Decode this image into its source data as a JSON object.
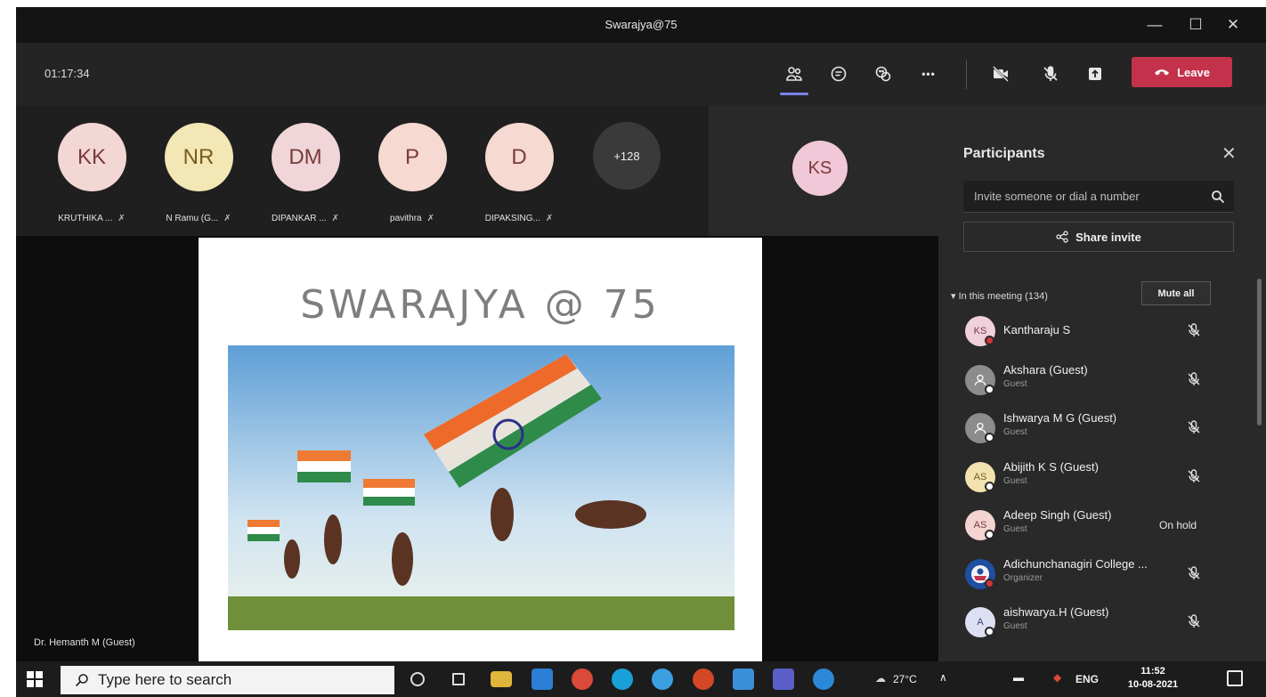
{
  "window": {
    "title": "Swarajya@75"
  },
  "window_controls": {
    "minimize": "—",
    "maximize": "☐",
    "close": "✕"
  },
  "toolbar": {
    "timer": "01:17:34",
    "leave_label": "Leave",
    "more_label": "•••",
    "icons": [
      "people-icon",
      "chat-icon",
      "reactions-icon",
      "more-icon",
      "camera-off-icon",
      "mic-off-icon",
      "share-tray-icon"
    ]
  },
  "gallery": {
    "tiles": [
      {
        "initials": "KK",
        "name": "KRUTHIKA ...",
        "color": "#f3d7d4"
      },
      {
        "initials": "NR",
        "name": "N Ramu (G...",
        "color": "#f2e7b5"
      },
      {
        "initials": "DM",
        "name": "DIPANKAR ...",
        "color": "#f0d6d9"
      },
      {
        "initials": "P",
        "name": "pavithra",
        "color": "#f6d9d0"
      },
      {
        "initials": "D",
        "name": "DIPAKSING...",
        "color": "#f6d9d0"
      }
    ],
    "overflow_count": "+128",
    "spotlight_initials": "KS"
  },
  "stage": {
    "slide_title": "SWARAJYA @ 75",
    "presenter": "Dr. Hemanth M (Guest)"
  },
  "panel": {
    "title": "Participants",
    "close": "✕",
    "invite_placeholder": "Invite someone or dial a number",
    "share_invite": "Share invite",
    "section": "In this meeting (134)",
    "mute_all": "Mute all",
    "participants": [
      {
        "initials": "KS",
        "name": "Kantharaju S",
        "role": "",
        "status": "",
        "avatar_color": "#f0d0dc"
      },
      {
        "initials": "",
        "name": "Akshara (Guest)",
        "role": "Guest",
        "status": "",
        "avatar_color": "#8c8c8c"
      },
      {
        "initials": "",
        "name": "Ishwarya M G (Guest)",
        "role": "Guest",
        "status": "",
        "avatar_color": "#8c8c8c"
      },
      {
        "initials": "AS",
        "name": "Abijith K S (Guest)",
        "role": "Guest",
        "status": "",
        "avatar_color": "#f2e2b0"
      },
      {
        "initials": "AS",
        "name": "Adeep Singh (Guest)",
        "role": "Guest",
        "status": "On hold",
        "avatar_color": "#f3d4d0"
      },
      {
        "initials": "",
        "name": "Adichunchanagiri College ...",
        "role": "Organizer",
        "status": "",
        "avatar_color": "#1e4fa0"
      },
      {
        "initials": "A",
        "name": "aishwarya.H (Guest)",
        "role": "Guest",
        "status": "",
        "avatar_color": "#dde0f3"
      }
    ]
  },
  "taskbar": {
    "search_placeholder": "Type here to search",
    "temperature": "27°C",
    "language": "ENG",
    "time": "11:52",
    "date": "10-08-2021"
  }
}
